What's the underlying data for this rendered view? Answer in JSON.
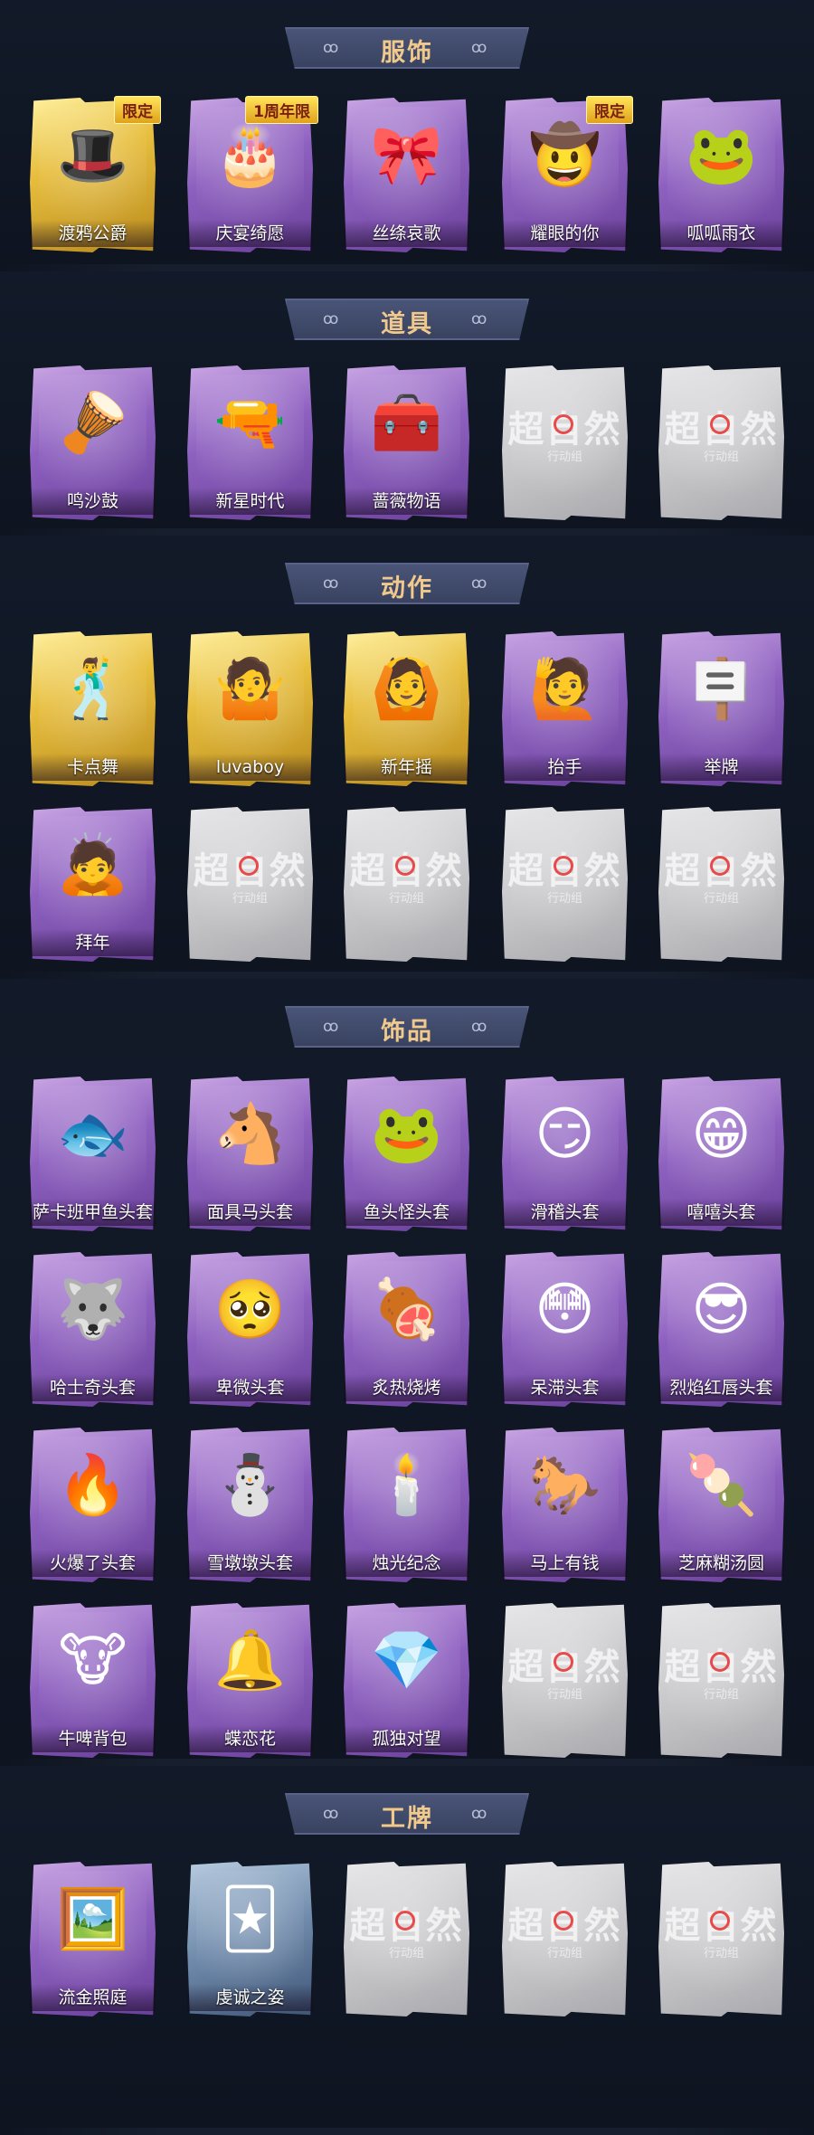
{
  "sections": [
    {
      "title": "服饰",
      "rows": [
        [
          {
            "label": "渡鸦公爵",
            "style": "gold",
            "icon": "noble-portrait-icon",
            "art": "🎩",
            "badge": "限定"
          },
          {
            "label": "庆宴绮愿",
            "style": "purple",
            "icon": "cake-girl-icon",
            "art": "🎂",
            "badge": "1周年限"
          },
          {
            "label": "丝绦哀歌",
            "style": "purple",
            "icon": "doll-girl-icon",
            "art": "🎀"
          },
          {
            "label": "耀眼的你",
            "style": "purple",
            "icon": "cowgirl-icon",
            "art": "🤠",
            "badge": "限定"
          },
          {
            "label": "呱呱雨衣",
            "style": "purple",
            "icon": "frog-hat-girl-icon",
            "art": "🐸"
          }
        ]
      ]
    },
    {
      "title": "道具",
      "rows": [
        [
          {
            "label": "鸣沙鼓",
            "style": "purple",
            "icon": "dreamcatcher-icon",
            "art": "🪘"
          },
          {
            "label": "新星时代",
            "style": "purple",
            "icon": "revolver-icon",
            "art": "🔫"
          },
          {
            "label": "蔷薇物语",
            "style": "purple",
            "icon": "medkit-icon",
            "art": "🧰"
          },
          {
            "label": "",
            "style": "gray",
            "icon": "placeholder-logo-icon",
            "placeholder": true
          },
          {
            "label": "",
            "style": "gray",
            "icon": "placeholder-logo-icon",
            "placeholder": true
          }
        ]
      ]
    },
    {
      "title": "动作",
      "rows": [
        [
          {
            "label": "卡点舞",
            "style": "gold",
            "icon": "dance-pose-icon",
            "art": "🕺"
          },
          {
            "label": "luvaboy",
            "style": "gold",
            "icon": "heart-pose-icon",
            "art": "🤷"
          },
          {
            "label": "新年摇",
            "style": "gold",
            "icon": "shake-pose-icon",
            "art": "🙆"
          },
          {
            "label": "抬手",
            "style": "purple",
            "icon": "raise-hand-pose-icon",
            "art": "🙋"
          },
          {
            "label": "举牌",
            "style": "purple",
            "icon": "sign-pose-icon",
            "art": "🪧"
          }
        ],
        [
          {
            "label": "拜年",
            "style": "purple",
            "icon": "bow-pose-icon",
            "art": "🙇"
          },
          {
            "label": "",
            "style": "gray",
            "icon": "placeholder-logo-icon",
            "placeholder": true
          },
          {
            "label": "",
            "style": "gray",
            "icon": "placeholder-logo-icon",
            "placeholder": true
          },
          {
            "label": "",
            "style": "gray",
            "icon": "placeholder-logo-icon",
            "placeholder": true
          },
          {
            "label": "",
            "style": "gray",
            "icon": "placeholder-logo-icon",
            "placeholder": true
          }
        ]
      ]
    },
    {
      "title": "饰品",
      "rows": [
        [
          {
            "label": "萨卡班甲鱼头套",
            "style": "purple",
            "icon": "fish-head-icon",
            "art": "🐟"
          },
          {
            "label": "面具马头套",
            "style": "purple",
            "icon": "horse-head-icon",
            "art": "🐴"
          },
          {
            "label": "鱼头怪头套",
            "style": "purple",
            "icon": "fishman-head-icon",
            "art": "🐸"
          },
          {
            "label": "滑稽头套",
            "style": "purple",
            "icon": "smirk-face-icon",
            "art": "😏"
          },
          {
            "label": "嘻嘻头套",
            "style": "purple",
            "icon": "grin-face-icon",
            "art": "😁"
          }
        ],
        [
          {
            "label": "哈士奇头套",
            "style": "purple",
            "icon": "husky-head-icon",
            "art": "🐺"
          },
          {
            "label": "卑微头套",
            "style": "purple",
            "icon": "humble-face-icon",
            "art": "🥺"
          },
          {
            "label": "炙热烧烤",
            "style": "purple",
            "icon": "bbq-icon",
            "art": "🍖"
          },
          {
            "label": "呆滞头套",
            "style": "purple",
            "icon": "dazed-face-icon",
            "art": "😳"
          },
          {
            "label": "烈焰红唇头套",
            "style": "purple",
            "icon": "pikachu-sunglasses-icon",
            "art": "😎"
          }
        ],
        [
          {
            "label": "火爆了头套",
            "style": "purple",
            "icon": "fire-face-icon",
            "art": "🔥"
          },
          {
            "label": "雪墩墩头套",
            "style": "purple",
            "icon": "snowman-icon",
            "art": "⛄"
          },
          {
            "label": "烛光纪念",
            "style": "purple",
            "icon": "candle-icon",
            "art": "🕯️"
          },
          {
            "label": "马上有钱",
            "style": "purple",
            "icon": "red-horse-icon",
            "art": "🐎"
          },
          {
            "label": "芝麻糊汤圆",
            "style": "purple",
            "icon": "tangyuan-icon",
            "art": "🍡"
          }
        ],
        [
          {
            "label": "牛啤背包",
            "style": "purple",
            "icon": "cow-beer-backpack-icon",
            "art": "🐮"
          },
          {
            "label": "蝶恋花",
            "style": "purple",
            "icon": "bell-ornament-icon",
            "art": "🔔"
          },
          {
            "label": "孤独对望",
            "style": "purple",
            "icon": "crystal-ornament-icon",
            "art": "💎"
          },
          {
            "label": "",
            "style": "gray",
            "icon": "placeholder-logo-icon",
            "placeholder": true
          },
          {
            "label": "",
            "style": "gray",
            "icon": "placeholder-logo-icon",
            "placeholder": true
          }
        ]
      ]
    },
    {
      "title": "工牌",
      "rows": [
        [
          {
            "label": "流金照庭",
            "style": "purple",
            "icon": "golden-frame-card-icon",
            "art": "🖼️"
          },
          {
            "label": "虔诚之姿",
            "style": "blue",
            "icon": "silhouette-card-icon",
            "art": "🃏"
          },
          {
            "label": "",
            "style": "gray",
            "icon": "placeholder-logo-icon",
            "placeholder": true
          },
          {
            "label": "",
            "style": "gray",
            "icon": "placeholder-logo-icon",
            "placeholder": true
          },
          {
            "label": "",
            "style": "gray",
            "icon": "placeholder-logo-icon",
            "placeholder": true
          }
        ]
      ]
    }
  ],
  "placeholder": {
    "logo": "超自然",
    "sub": "行动组"
  },
  "colors": {
    "background": "#0f1623",
    "banner": "#3d4766",
    "banner_text": "#f2c98c"
  }
}
